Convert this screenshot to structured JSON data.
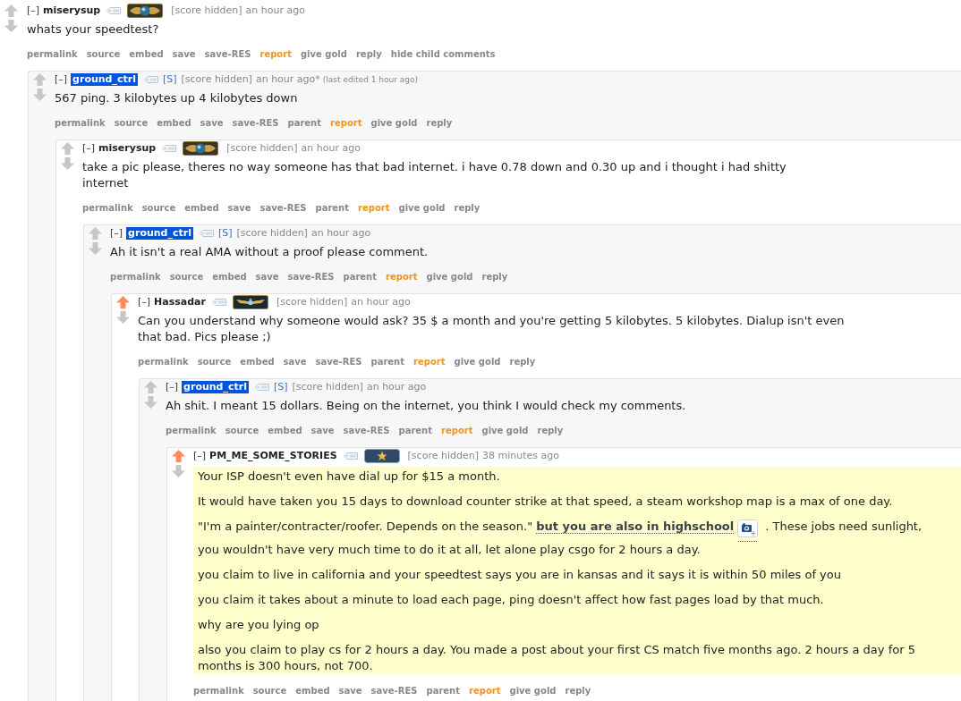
{
  "comments": [
    {
      "upvoted": false,
      "toggle": "[–]",
      "author": "miserysup",
      "submitter": false,
      "flair": {
        "kind": "globe"
      },
      "score": "[score hidden]",
      "time": "an hour ago",
      "highlighted": false,
      "paragraphs": [
        {
          "kind": "plain",
          "text": "whats your speedtest?"
        }
      ],
      "buttons": [
        {
          "label": "permalink",
          "kind": "action"
        },
        {
          "label": "source",
          "kind": "action"
        },
        {
          "label": "embed",
          "kind": "action"
        },
        {
          "label": "save",
          "kind": "action"
        },
        {
          "label": "save-RES",
          "kind": "action"
        },
        {
          "label": "report",
          "kind": "report"
        },
        {
          "label": "give gold",
          "kind": "action"
        },
        {
          "label": "reply",
          "kind": "action"
        },
        {
          "label": "hide child comments",
          "kind": "action"
        }
      ],
      "children": [
        {
          "upvoted": false,
          "toggle": "[–]",
          "author": "ground_ctrl",
          "submitter": true,
          "submitter_mark": "[S]",
          "score": "[score hidden]",
          "time": "an hour ago",
          "edited_mark": "*",
          "edited_note": "(last edited 1 hour ago)",
          "highlighted": false,
          "paragraphs": [
            {
              "kind": "plain",
              "text": "567 ping. 3 kilobytes up 4 kilobytes down"
            }
          ],
          "buttons": [
            {
              "label": "permalink",
              "kind": "action"
            },
            {
              "label": "source",
              "kind": "action"
            },
            {
              "label": "embed",
              "kind": "action"
            },
            {
              "label": "save",
              "kind": "action"
            },
            {
              "label": "save-RES",
              "kind": "action"
            },
            {
              "label": "parent",
              "kind": "action"
            },
            {
              "label": "report",
              "kind": "report"
            },
            {
              "label": "give gold",
              "kind": "action"
            },
            {
              "label": "reply",
              "kind": "action"
            }
          ],
          "children": [
            {
              "upvoted": false,
              "toggle": "[–]",
              "author": "miserysup",
              "submitter": false,
              "flair": {
                "kind": "globe"
              },
              "score": "[score hidden]",
              "time": "an hour ago",
              "highlighted": false,
              "paragraphs": [
                {
                  "kind": "plain",
                  "text": "take a pic please, theres no way someone has that bad internet. i have 0.78 down and 0.30 up and i thought i had shitty internet"
                }
              ],
              "buttons": [
                {
                  "label": "permalink",
                  "kind": "action"
                },
                {
                  "label": "source",
                  "kind": "action"
                },
                {
                  "label": "embed",
                  "kind": "action"
                },
                {
                  "label": "save",
                  "kind": "action"
                },
                {
                  "label": "save-RES",
                  "kind": "action"
                },
                {
                  "label": "parent",
                  "kind": "action"
                },
                {
                  "label": "report",
                  "kind": "report"
                },
                {
                  "label": "give gold",
                  "kind": "action"
                },
                {
                  "label": "reply",
                  "kind": "action"
                }
              ],
              "children": [
                {
                  "upvoted": false,
                  "toggle": "[–]",
                  "author": "ground_ctrl",
                  "submitter": true,
                  "submitter_mark": "[S]",
                  "score": "[score hidden]",
                  "time": "an hour ago",
                  "highlighted": false,
                  "paragraphs": [
                    {
                      "kind": "plain",
                      "text": "Ah it isn't a real AMA without a proof please comment."
                    }
                  ],
                  "buttons": [
                    {
                      "label": "permalink",
                      "kind": "action"
                    },
                    {
                      "label": "source",
                      "kind": "action"
                    },
                    {
                      "label": "embed",
                      "kind": "action"
                    },
                    {
                      "label": "save",
                      "kind": "action"
                    },
                    {
                      "label": "save-RES",
                      "kind": "action"
                    },
                    {
                      "label": "parent",
                      "kind": "action"
                    },
                    {
                      "label": "report",
                      "kind": "report"
                    },
                    {
                      "label": "give gold",
                      "kind": "action"
                    },
                    {
                      "label": "reply",
                      "kind": "action"
                    }
                  ],
                  "children": [
                    {
                      "upvoted": true,
                      "toggle": "[–]",
                      "author": "Hassadar",
                      "submitter": false,
                      "flair": {
                        "kind": "eagle"
                      },
                      "score": "[score hidden]",
                      "time": "an hour ago",
                      "highlighted": false,
                      "paragraphs": [
                        {
                          "kind": "plain",
                          "text": "Can you understand why someone would ask? 35 $ a month and you're getting 5 kilobytes. 5 kilobytes. Dialup isn't even that bad. Pics please ;)"
                        }
                      ],
                      "buttons": [
                        {
                          "label": "permalink",
                          "kind": "action"
                        },
                        {
                          "label": "source",
                          "kind": "action"
                        },
                        {
                          "label": "embed",
                          "kind": "action"
                        },
                        {
                          "label": "save",
                          "kind": "action"
                        },
                        {
                          "label": "save-RES",
                          "kind": "action"
                        },
                        {
                          "label": "parent",
                          "kind": "action"
                        },
                        {
                          "label": "report",
                          "kind": "report"
                        },
                        {
                          "label": "give gold",
                          "kind": "action"
                        },
                        {
                          "label": "reply",
                          "kind": "action"
                        }
                      ],
                      "children": [
                        {
                          "upvoted": false,
                          "toggle": "[–]",
                          "author": "ground_ctrl",
                          "submitter": true,
                          "submitter_mark": "[S]",
                          "score": "[score hidden]",
                          "time": "an hour ago",
                          "highlighted": false,
                          "paragraphs": [
                            {
                              "kind": "plain",
                              "text": "Ah shit. I meant 15 dollars. Being on the internet, you think I would check my comments."
                            }
                          ],
                          "buttons": [
                            {
                              "label": "permalink",
                              "kind": "action"
                            },
                            {
                              "label": "source",
                              "kind": "action"
                            },
                            {
                              "label": "embed",
                              "kind": "action"
                            },
                            {
                              "label": "save",
                              "kind": "action"
                            },
                            {
                              "label": "save-RES",
                              "kind": "action"
                            },
                            {
                              "label": "parent",
                              "kind": "action"
                            },
                            {
                              "label": "report",
                              "kind": "report"
                            },
                            {
                              "label": "give gold",
                              "kind": "action"
                            },
                            {
                              "label": "reply",
                              "kind": "action"
                            }
                          ],
                          "children": [
                            {
                              "upvoted": true,
                              "toggle": "[–]",
                              "author": "PM_ME_SOME_STORIES",
                              "submitter": false,
                              "flair": {
                                "kind": "star"
                              },
                              "score": "[score hidden]",
                              "time": "38 minutes ago",
                              "highlighted": true,
                              "paragraphs": [
                                {
                                  "kind": "plain",
                                  "text": "Your ISP doesn't even have dial up for $15 a month."
                                },
                                {
                                  "kind": "plain",
                                  "text": "It would have taken you 15 days to download counter strike at that speed, a steam workshop map is a max of one day."
                                },
                                {
                                  "kind": "link_with_image",
                                  "before": "\"I'm a painter/contracter/roofer. Depends on the season.\" ",
                                  "link": "but you are also in highschool",
                                  "after": ". These jobs need sunlight, you wouldn't have very much time to do it at all, let alone play csgo for 2 hours a day."
                                },
                                {
                                  "kind": "plain",
                                  "text": "you claim to live in california and your speedtest says you are in kansas and it says it is within 50 miles of you"
                                },
                                {
                                  "kind": "plain",
                                  "text": "you claim it takes about a minute to load each page, ping doesn't affect how fast pages load by that much."
                                },
                                {
                                  "kind": "plain",
                                  "text": "why are you lying op"
                                },
                                {
                                  "kind": "plain",
                                  "text": "also you claim to play cs for 2 hours a day. You made a post about your first CS match five months ago. 2 hours a day for 5 months is 300 hours, not 700."
                                }
                              ],
                              "buttons": [
                                {
                                  "label": "permalink",
                                  "kind": "action"
                                },
                                {
                                  "label": "source",
                                  "kind": "action"
                                },
                                {
                                  "label": "embed",
                                  "kind": "action"
                                },
                                {
                                  "label": "save",
                                  "kind": "action"
                                },
                                {
                                  "label": "save-RES",
                                  "kind": "action"
                                },
                                {
                                  "label": "parent",
                                  "kind": "action"
                                },
                                {
                                  "label": "report",
                                  "kind": "report"
                                },
                                {
                                  "label": "give gold",
                                  "kind": "action"
                                },
                                {
                                  "label": "reply",
                                  "kind": "action"
                                }
                              ]
                            }
                          ]
                        }
                      ]
                    }
                  ]
                }
              ]
            }
          ]
        }
      ]
    }
  ]
}
